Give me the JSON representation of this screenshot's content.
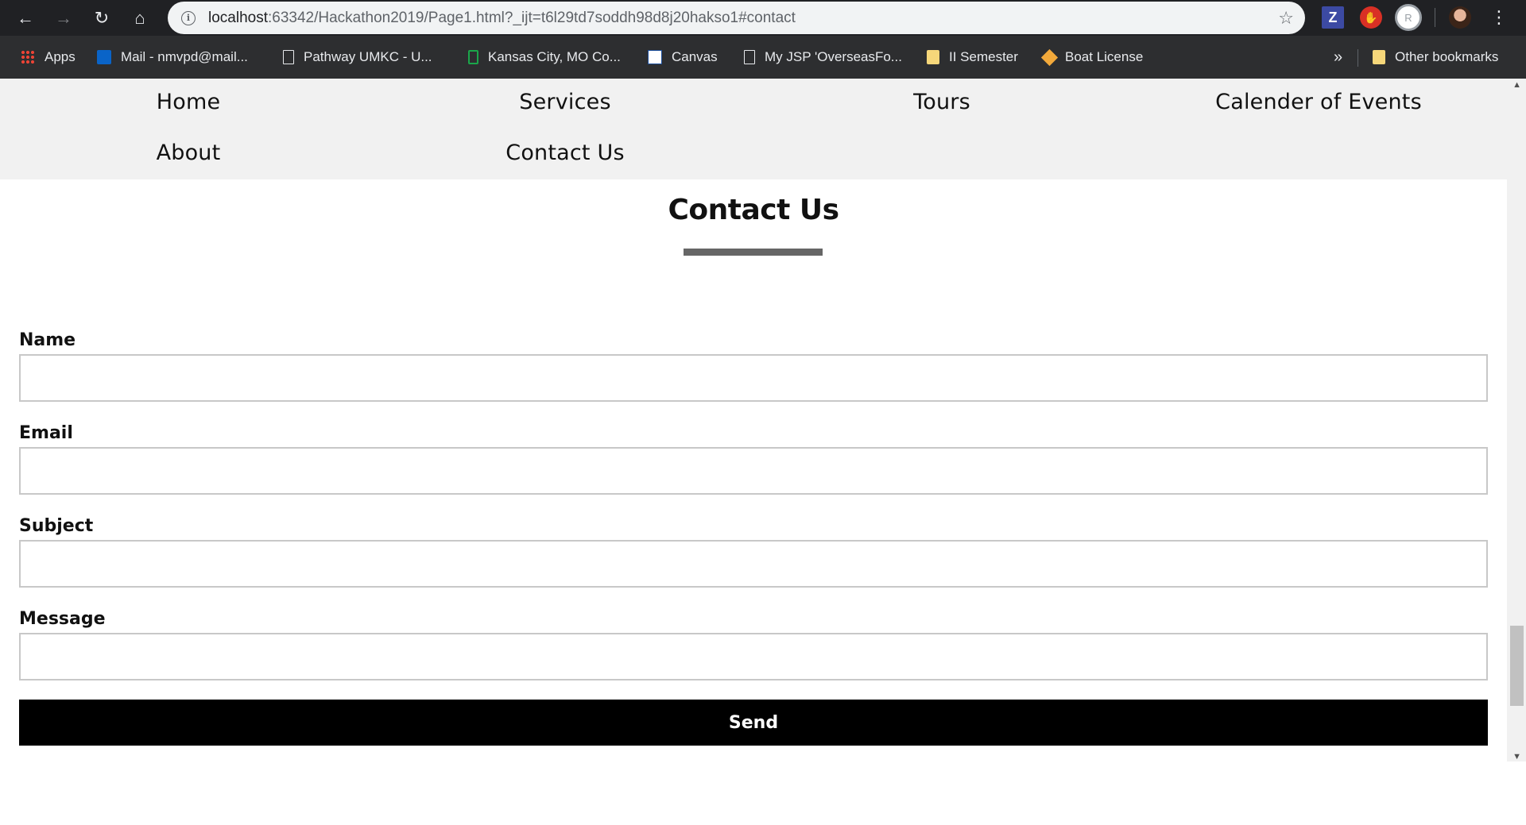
{
  "browser": {
    "url_host": "localhost",
    "url_rest": ":63342/Hackathon2019/Page1.html?_ijt=t6l29td7soddh98d8j20hakso1#contact",
    "extensions": [
      {
        "name": "z-extension-icon",
        "glyph": "Z"
      },
      {
        "name": "adblock-icon",
        "glyph": "✋"
      },
      {
        "name": "r-extension-icon",
        "glyph": "R"
      }
    ],
    "bookmarks": [
      {
        "label": "Apps",
        "icon": "apps-grid-icon"
      },
      {
        "label": "Mail - nmvpd@mail...",
        "icon": "outlook-icon"
      },
      {
        "label": "Pathway UMKC - U...",
        "icon": "page-icon"
      },
      {
        "label": "Kansas City, MO Co...",
        "icon": "phone-icon"
      },
      {
        "label": "Canvas",
        "icon": "umkc-icon"
      },
      {
        "label": "My JSP 'OverseasFo...",
        "icon": "page-icon"
      },
      {
        "label": "II Semester",
        "icon": "folder-icon"
      },
      {
        "label": "Boat License",
        "icon": "boat-icon"
      }
    ],
    "overflow_glyph": "»",
    "other_bookmarks": "Other bookmarks"
  },
  "site_nav": {
    "items": [
      "Home",
      "Services",
      "Tours",
      "Calender of Events",
      "About",
      "Contact Us"
    ]
  },
  "contact": {
    "title": "Contact Us",
    "fields": [
      {
        "label": "Name",
        "value": "",
        "placeholder": ""
      },
      {
        "label": "Email",
        "value": "",
        "placeholder": ""
      },
      {
        "label": "Subject",
        "value": "",
        "placeholder": ""
      },
      {
        "label": "Message",
        "value": "",
        "placeholder": ""
      }
    ],
    "submit_label": "Send"
  },
  "colors": {
    "chrome_toolbar": "#202124",
    "bookmarks_bar": "#2d2e30",
    "nav_background": "#f1f1f1",
    "title_underline": "#666666",
    "send_button": "#000000"
  }
}
